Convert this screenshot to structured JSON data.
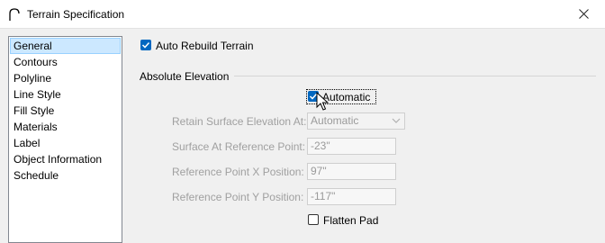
{
  "window": {
    "title": "Terrain Specification",
    "icon": "arc-icon",
    "close_icon": "close-icon"
  },
  "sidebar": {
    "items": [
      {
        "label": "General",
        "selected": true
      },
      {
        "label": "Contours"
      },
      {
        "label": "Polyline"
      },
      {
        "label": "Line Style"
      },
      {
        "label": "Fill Style"
      },
      {
        "label": "Materials"
      },
      {
        "label": "Label"
      },
      {
        "label": "Object Information"
      },
      {
        "label": "Schedule"
      }
    ]
  },
  "general": {
    "auto_rebuild_label": "Auto Rebuild Terrain",
    "auto_rebuild_checked": true,
    "group_title": "Absolute Elevation",
    "automatic_label": "Automatic",
    "automatic_checked": true,
    "retain_label": "Retain Surface Elevation At:",
    "retain_value": "Automatic",
    "surface_label": "Surface At Reference Point:",
    "surface_value": "-23\"",
    "ref_x_label": "Reference Point X Position:",
    "ref_x_value": "97\"",
    "ref_y_label": "Reference Point Y Position:",
    "ref_y_value": "-117\"",
    "flatten_label": "Flatten Pad",
    "flatten_checked": false
  },
  "colors": {
    "accent": "#0067c0",
    "selection": "#cce8ff",
    "disabled_text": "#a0a0a0"
  }
}
